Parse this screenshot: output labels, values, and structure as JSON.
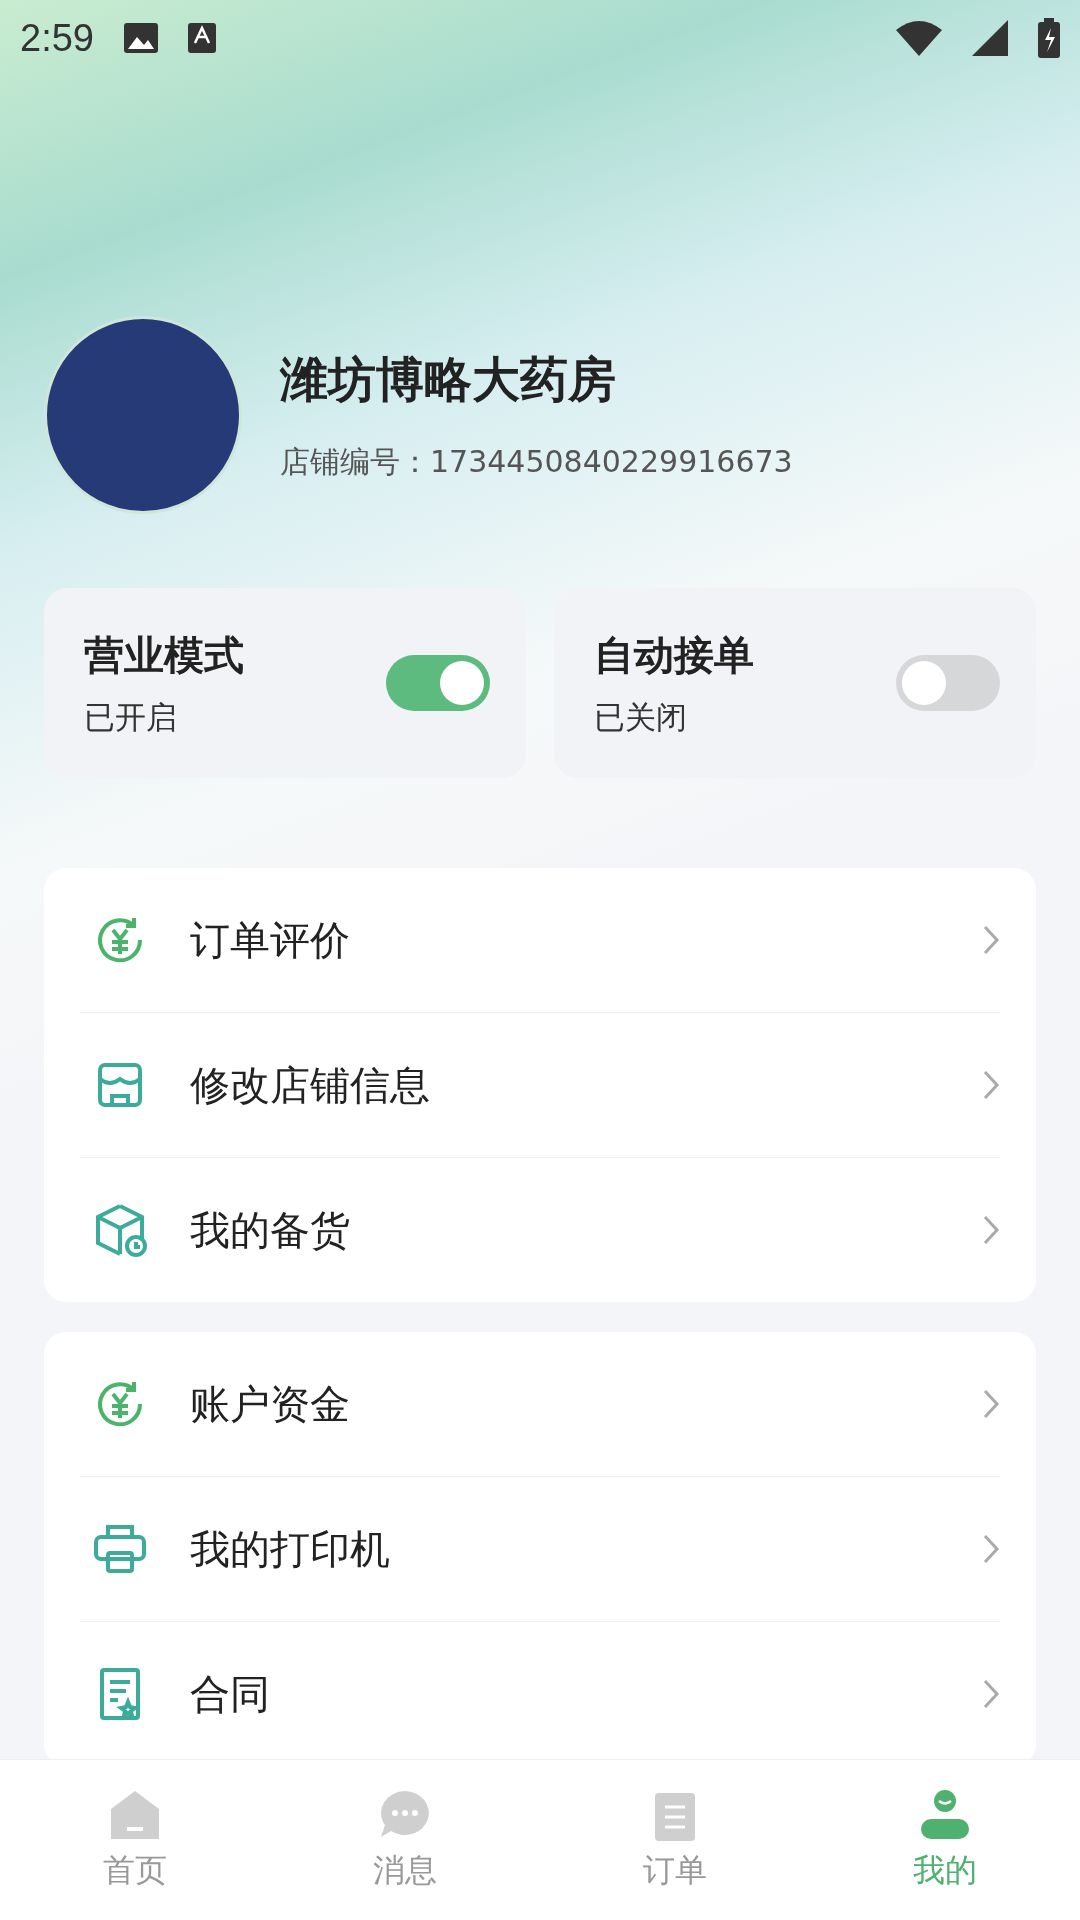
{
  "status_bar": {
    "time": "2:59"
  },
  "profile": {
    "store_name": "潍坊博略大药房",
    "store_number": "店铺编号：1734450840229916673"
  },
  "toggles": [
    {
      "title": "营业模式",
      "status": "已开启",
      "on": true
    },
    {
      "title": "自动接单",
      "status": "已关闭",
      "on": false
    }
  ],
  "menu_groups": [
    {
      "items": [
        {
          "label": "订单评价"
        },
        {
          "label": "修改店铺信息"
        },
        {
          "label": "我的备货"
        }
      ]
    },
    {
      "items": [
        {
          "label": "账户资金"
        },
        {
          "label": "我的打印机"
        },
        {
          "label": "合同"
        }
      ]
    }
  ],
  "bottom_nav": [
    {
      "label": "首页",
      "selected": false
    },
    {
      "label": "消息",
      "selected": false
    },
    {
      "label": "订单",
      "selected": false
    },
    {
      "label": "我的",
      "selected": true
    }
  ]
}
